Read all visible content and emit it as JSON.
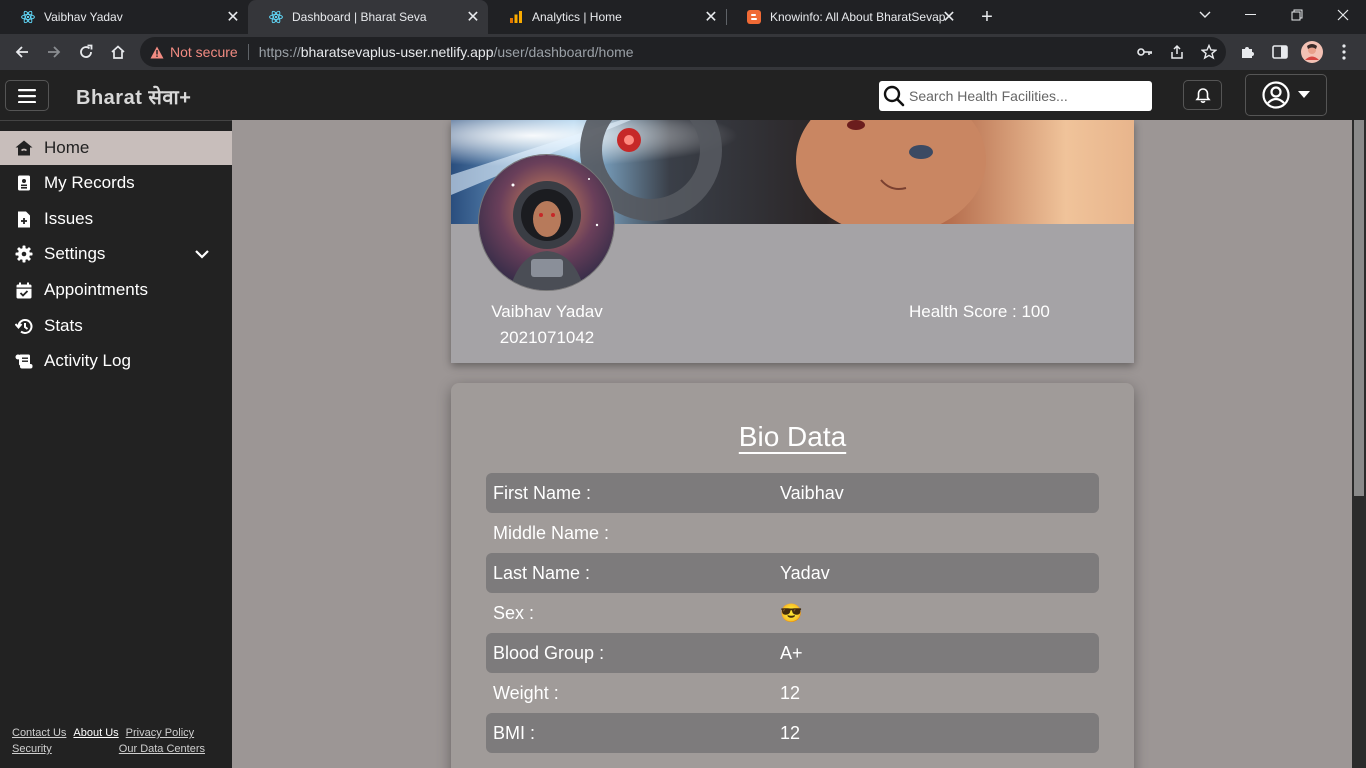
{
  "browser": {
    "tabs": [
      {
        "title": "Vaibhav Yadav",
        "icon": "react-icon"
      },
      {
        "title": "Dashboard | Bharat Seva",
        "icon": "react-icon"
      },
      {
        "title": "Analytics | Home",
        "icon": "analytics-icon"
      },
      {
        "title": "Knowinfo: All About BharatSevap",
        "icon": "blogger-icon"
      }
    ],
    "active_tab_index": 1,
    "omnibox": {
      "security_label": "Not secure",
      "scheme": "https://",
      "host": "bharatsevaplus-user.netlify.app",
      "path": "/user/dashboard/home"
    }
  },
  "app": {
    "brand": "Bharat सेवा+",
    "search": {
      "placeholder": "Search Health Facilities..."
    }
  },
  "sidebar": {
    "items": [
      {
        "label": "Home",
        "icon": "home-icon",
        "active": true
      },
      {
        "label": "My Records",
        "icon": "records-icon"
      },
      {
        "label": "Issues",
        "icon": "file-plus-icon"
      },
      {
        "label": "Settings",
        "icon": "gear-icon",
        "expandable": true
      },
      {
        "label": "Appointments",
        "icon": "calendar-check-icon"
      },
      {
        "label": "Stats",
        "icon": "history-icon"
      },
      {
        "label": "Activity Log",
        "icon": "scroll-icon"
      }
    ],
    "footer_links": [
      "Contact Us",
      "About Us",
      "Privacy Policy",
      "Security",
      "Our Data Centers"
    ]
  },
  "profile": {
    "name": "Vaibhav Yadav",
    "id": "2021071042",
    "health_score": "Health Score : 100"
  },
  "bio": {
    "title": "Bio Data",
    "rows": [
      {
        "label": "First Name :",
        "value": "Vaibhav"
      },
      {
        "label": "Middle Name :",
        "value": ""
      },
      {
        "label": "Last Name :",
        "value": "Yadav"
      },
      {
        "label": "Sex :",
        "value": "😎"
      },
      {
        "label": "Blood Group :",
        "value": "A+"
      },
      {
        "label": "Weight :",
        "value": "12"
      },
      {
        "label": "BMI :",
        "value": "12"
      }
    ]
  },
  "colors": {
    "sidebar_bg": "#222222",
    "main_bg": "#9c9695",
    "active_nav": "#c8bebb",
    "shaded_row": "#7d7b7c",
    "not_secure": "#f28b82"
  }
}
